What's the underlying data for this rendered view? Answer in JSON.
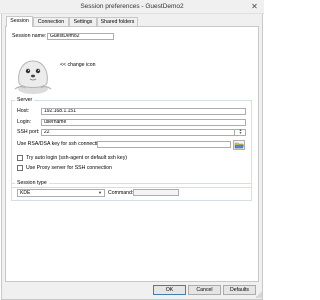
{
  "window": {
    "title": "Session preferences - GuestDemo2"
  },
  "tabs": [
    {
      "label": "Session",
      "active": true
    },
    {
      "label": "Connection",
      "active": false
    },
    {
      "label": "Settings",
      "active": false
    },
    {
      "label": "Shared folders",
      "active": false
    }
  ],
  "session": {
    "name_label": "Session name:",
    "name_value": "GuestDemo2",
    "change_icon_label": "<< change icon"
  },
  "server": {
    "group_title": "Server",
    "host_label": "Host:",
    "host_value": "192.168.1.151",
    "login_label": "Login:",
    "login_value": "username",
    "port_label": "SSH port:",
    "port_value": "22",
    "rsa_label": "Use RSA/DSA key for ssh connection:",
    "rsa_value": "",
    "auto_login_label": "Try auto login (ssh-agent or default ssh key)",
    "auto_login_checked": false,
    "proxy_label": "Use Proxy server for SSH connection",
    "proxy_checked": false
  },
  "session_type": {
    "group_title": "Session type",
    "selected": "KDE",
    "command_label": "Command:",
    "command_value": ""
  },
  "buttons": {
    "ok": "OK",
    "cancel": "Cancel",
    "defaults": "Defaults"
  },
  "colors": {
    "accent": "#3c7fb1",
    "chrome": "#f0f0f0",
    "border": "#c8c8c8"
  },
  "icons": {
    "session_icon": "seal-icon",
    "browse": "folder-open-icon",
    "close": "close-icon"
  }
}
